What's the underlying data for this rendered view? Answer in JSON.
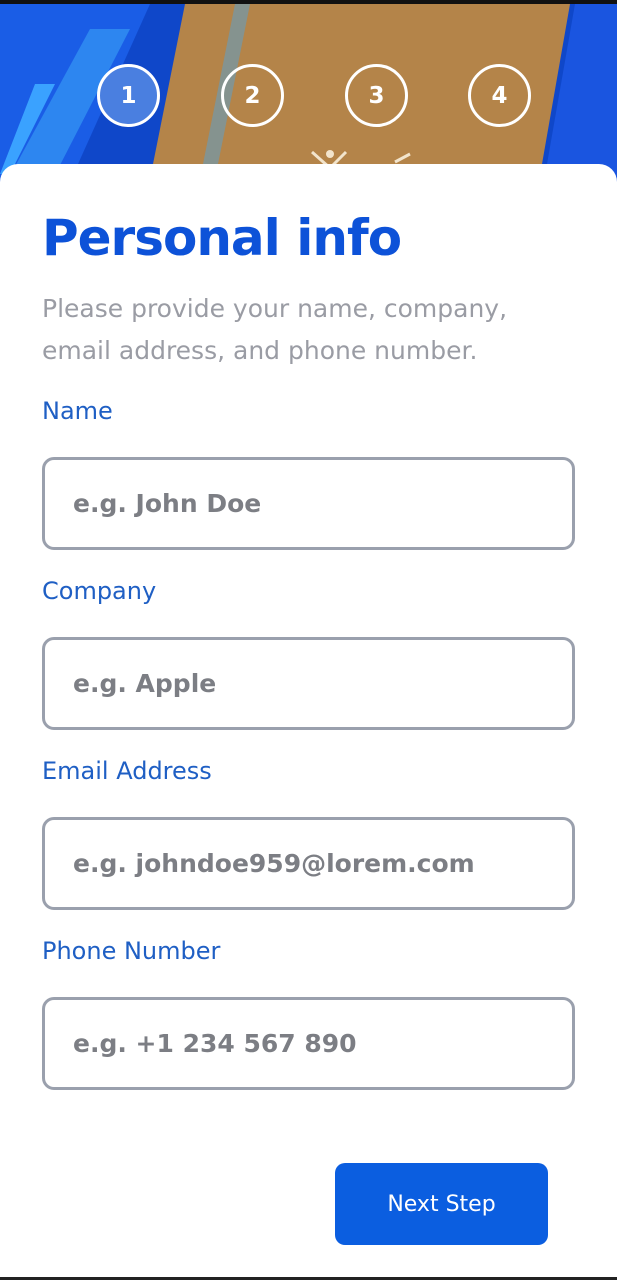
{
  "steps": [
    {
      "number": "1",
      "active": true
    },
    {
      "number": "2",
      "active": false
    },
    {
      "number": "3",
      "active": false
    },
    {
      "number": "4",
      "active": false
    }
  ],
  "form": {
    "title": "Personal info",
    "subtitle": "Please provide your name, company, email address, and phone number.",
    "fields": [
      {
        "label": "Name",
        "placeholder": "e.g. John Doe",
        "value": ""
      },
      {
        "label": "Company",
        "placeholder": "e.g. Apple",
        "value": ""
      },
      {
        "label": "Email Address",
        "placeholder": "e.g. johndoe959@lorem.com",
        "value": ""
      },
      {
        "label": "Phone Number",
        "placeholder": "e.g. +1 234 567 890",
        "value": ""
      }
    ],
    "next_label": "Next Step"
  },
  "colors": {
    "accent": "#0d52d8",
    "button": "#0b5ee0",
    "label": "#1f5fc4",
    "active_step": "#4a7fe0"
  }
}
